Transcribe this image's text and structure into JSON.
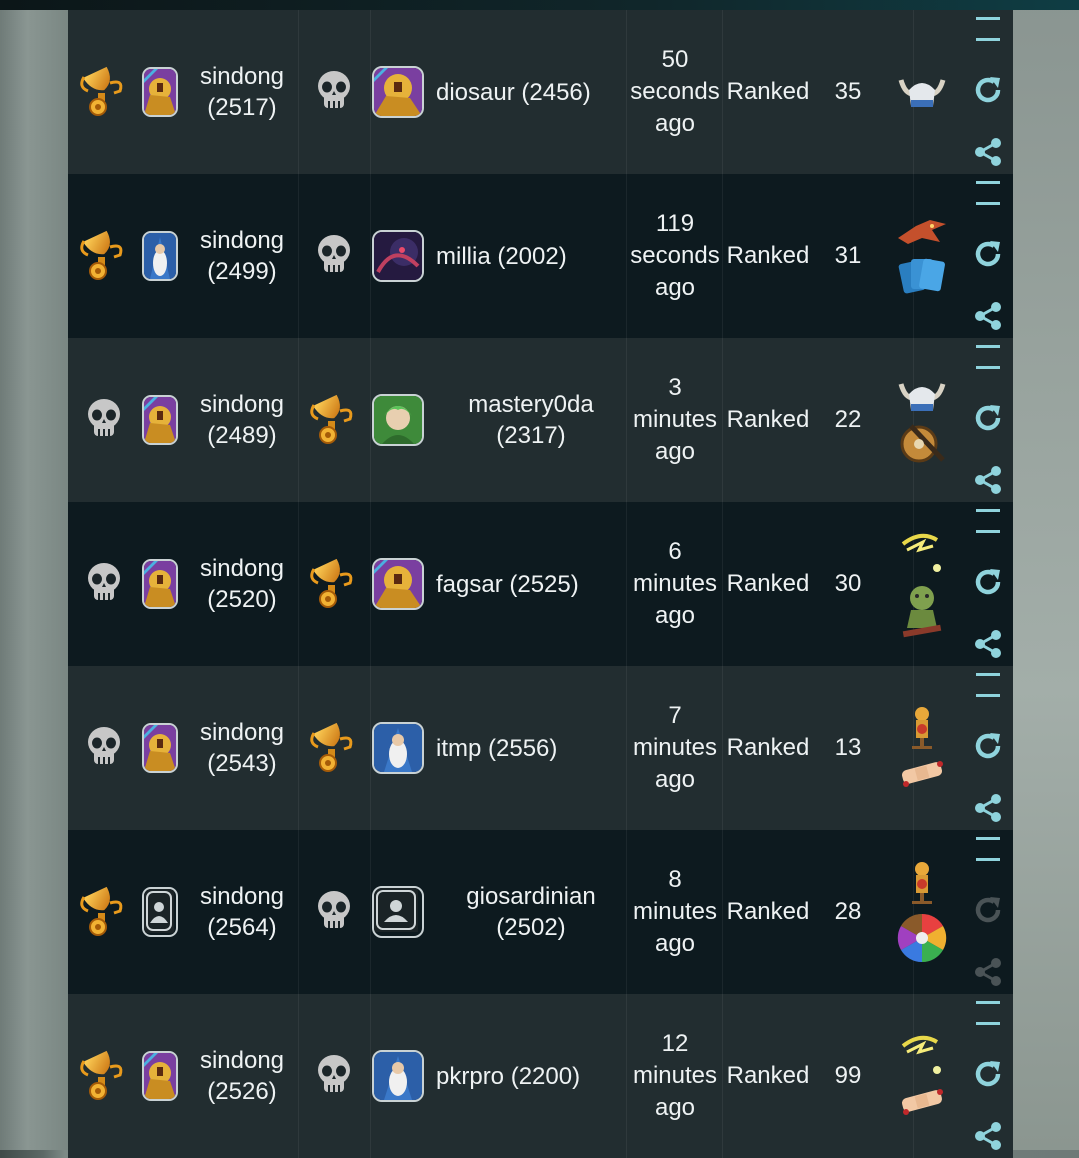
{
  "colors": {
    "row_alt": "#222d30",
    "row_dark": "#0d1a1f",
    "text": "#eef2f3",
    "action_teal": "#8fd3dc",
    "trophy_gold": "#e8a21c",
    "skull": "#c9c9c9"
  },
  "columns": [
    "result",
    "avatar",
    "player",
    "opponent_result",
    "opponent_avatar",
    "opponent",
    "time",
    "mode",
    "turns",
    "enchantments",
    "actions"
  ],
  "matches": [
    {
      "player_result": "trophy-icon",
      "player_avatar": "golden-knight-avatar",
      "player_name": "sindong",
      "player_rating": "(2517)",
      "opponent_result": "skull-icon",
      "opponent_avatar": "golden-knight-avatar",
      "opponent": "diosaur (2456)",
      "opponent_wrap": false,
      "time_value": "50",
      "time_unit": "seconds",
      "time_suffix": "ago",
      "mode": "Ranked",
      "turns": "35",
      "enchantments": [
        "horned-helmet-icon"
      ],
      "actions_enabled": true
    },
    {
      "player_result": "trophy-icon",
      "player_avatar": "wizard-avatar",
      "player_name": "sindong",
      "player_rating": "(2499)",
      "opponent_result": "skull-icon",
      "opponent_avatar": "dark-creature-avatar",
      "opponent": "millia (2002)",
      "opponent_wrap": false,
      "time_value": "119",
      "time_unit": "seconds",
      "time_suffix": "ago",
      "mode": "Ranked",
      "turns": "31",
      "enchantments": [
        "red-dragon-icon",
        "cards-icon"
      ],
      "actions_enabled": true
    },
    {
      "player_result": "skull-icon",
      "player_avatar": "golden-knight-avatar",
      "player_name": "sindong",
      "player_rating": "(2489)",
      "opponent_result": "trophy-icon",
      "opponent_avatar": "elf-avatar",
      "opponent": "mastery0da",
      "opponent_rating": "(2317)",
      "opponent_wrap": true,
      "time_value": "3",
      "time_unit": "minutes",
      "time_suffix": "ago",
      "mode": "Ranked",
      "turns": "22",
      "enchantments": [
        "horned-helmet-icon",
        "shield-icon"
      ],
      "actions_enabled": true
    },
    {
      "player_result": "skull-icon",
      "player_avatar": "golden-knight-avatar",
      "player_name": "sindong",
      "player_rating": "(2520)",
      "opponent_result": "trophy-icon",
      "opponent_avatar": "golden-knight-avatar",
      "opponent": "fagsar (2525)",
      "opponent_wrap": false,
      "time_value": "6",
      "time_unit": "minutes",
      "time_suffix": "ago",
      "mode": "Ranked",
      "turns": "30",
      "enchantments": [
        "lightning-icon",
        "goblin-icon"
      ],
      "actions_enabled": true
    },
    {
      "player_result": "skull-icon",
      "player_avatar": "golden-knight-avatar",
      "player_name": "sindong",
      "player_rating": "(2543)",
      "opponent_result": "trophy-icon",
      "opponent_avatar": "wizard-avatar",
      "opponent": "itmp (2556)",
      "opponent_wrap": false,
      "time_value": "7",
      "time_unit": "minutes",
      "time_suffix": "ago",
      "mode": "Ranked",
      "turns": "13",
      "enchantments": [
        "target-dummy-icon",
        "bandage-icon"
      ],
      "actions_enabled": true
    },
    {
      "player_result": "trophy-icon",
      "player_avatar": "default-avatar",
      "player_name": "sindong",
      "player_rating": "(2564)",
      "opponent_result": "skull-icon",
      "opponent_avatar": "default-avatar",
      "opponent": "giosardinian",
      "opponent_rating": "(2502)",
      "opponent_wrap": true,
      "time_value": "8",
      "time_unit": "minutes",
      "time_suffix": "ago",
      "mode": "Ranked",
      "turns": "28",
      "enchantments": [
        "target-dummy-icon",
        "color-wheel-icon"
      ],
      "actions_enabled": false
    },
    {
      "player_result": "trophy-icon",
      "player_avatar": "golden-knight-avatar",
      "player_name": "sindong",
      "player_rating": "(2526)",
      "opponent_result": "skull-icon",
      "opponent_avatar": "wizard-avatar",
      "opponent": "pkrpro (2200)",
      "opponent_wrap": false,
      "time_value": "12",
      "time_unit": "minutes",
      "time_suffix": "ago",
      "mode": "Ranked",
      "turns": "99",
      "enchantments": [
        "lightning-icon",
        "bandage-icon"
      ],
      "actions_enabled": true
    }
  ]
}
